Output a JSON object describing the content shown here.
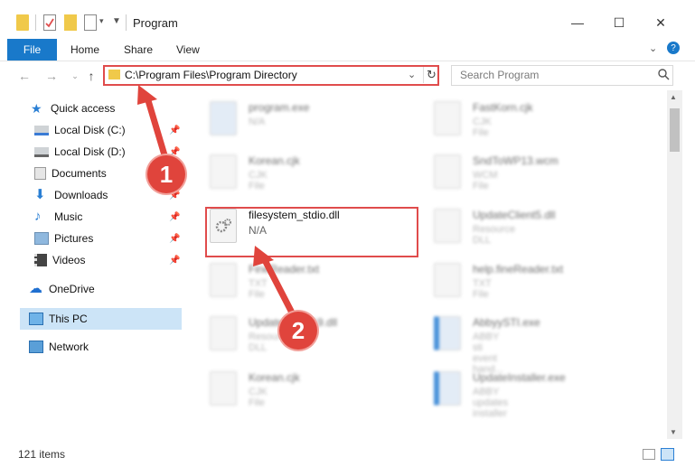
{
  "window": {
    "title": "Program",
    "minimize": "—",
    "maximize": "☐",
    "close": "✕"
  },
  "ribbon": {
    "file": "File",
    "home": "Home",
    "share": "Share",
    "view": "View"
  },
  "nav": {
    "address": "C:\\Program Files\\Program Directory",
    "search_placeholder": "Search Program"
  },
  "sidebar": {
    "quick_access": "Quick access",
    "items": [
      {
        "label": "Local Disk (C:)"
      },
      {
        "label": "Local Disk (D:)"
      },
      {
        "label": "Documents"
      },
      {
        "label": "Downloads"
      },
      {
        "label": "Music"
      },
      {
        "label": "Pictures"
      },
      {
        "label": "Videos"
      }
    ],
    "onedrive": "OneDrive",
    "thispc": "This PC",
    "network": "Network"
  },
  "files": {
    "left": [
      {
        "name": "program.exe",
        "type": "N/A"
      },
      {
        "name": "Korean.cjk",
        "type": "CJK File"
      },
      {
        "name": "filesystem_stdio.dll",
        "type": "N/A"
      },
      {
        "name": "FineReader.txt",
        "type": "TXT File"
      },
      {
        "name": "UpdateClient19.dll",
        "type": "Resource DLL"
      },
      {
        "name": "Korean.cjk",
        "type": "CJK File"
      }
    ],
    "right": [
      {
        "name": "FastKorn.cjk",
        "type": "CJK File"
      },
      {
        "name": "SndToWP13.wcm",
        "type": "WCM File"
      },
      {
        "name": "UpdateClient5.dll",
        "type": "Resource DLL"
      },
      {
        "name": "help.fineReader.txt",
        "type": "TXT File"
      },
      {
        "name": "AbbyySTI.exe",
        "type": "ABBY sti event hand..."
      },
      {
        "name": "UpdateInstaller.exe",
        "type": "ABBY updates installer"
      }
    ]
  },
  "status": {
    "count": "121 items"
  },
  "markers": {
    "one": "1",
    "two": "2"
  }
}
